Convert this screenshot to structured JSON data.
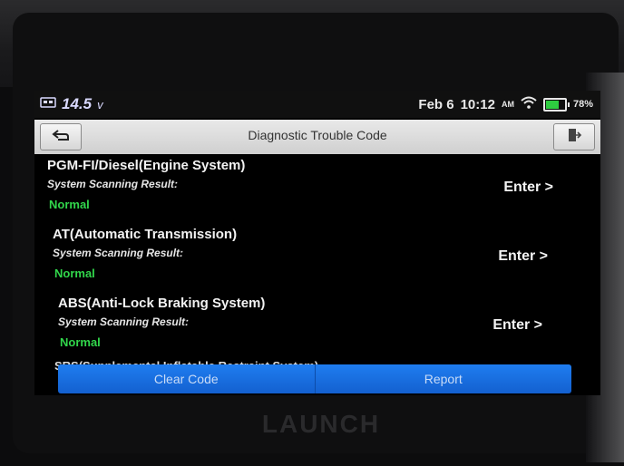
{
  "device": {
    "brand": "LAUNCH"
  },
  "statusbar": {
    "voltage": "14.5",
    "voltage_unit": "v",
    "date": "Feb 6",
    "time": "10:12",
    "ampm": "AM",
    "battery_percent": "78%",
    "battery_level": 0.78,
    "icons": [
      "vehicle-icon",
      "wifi-icon",
      "battery-icon"
    ]
  },
  "titlebar": {
    "title": "Diagnostic Trouble Code",
    "back_icon": "back-arrow-icon",
    "exit_icon": "exit-door-icon"
  },
  "systems": [
    {
      "name": "PGM-FI/Diesel(Engine System)",
      "sub": "System Scanning Result:",
      "result": "Normal",
      "action": "Enter >"
    },
    {
      "name": "AT(Automatic Transmission)",
      "sub": "System Scanning Result:",
      "result": "Normal",
      "action": "Enter >"
    },
    {
      "name": "ABS(Anti-Lock Braking System)",
      "sub": "System Scanning Result:",
      "result": "Normal",
      "action": "Enter >"
    }
  ],
  "partial_item": "SRS(Supplemental Inflatable Restraint System)",
  "bottom": {
    "clear_label": "Clear Code",
    "report_label": "Report"
  },
  "colors": {
    "normal": "#31d64b",
    "button_blue": "#1a72e6"
  }
}
